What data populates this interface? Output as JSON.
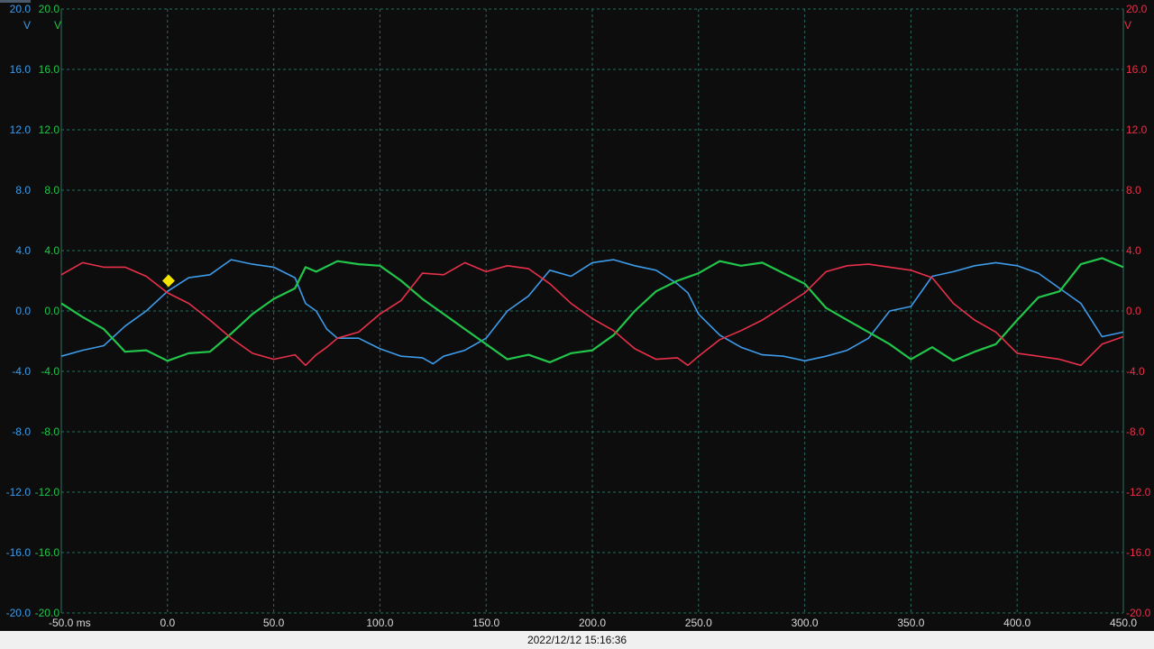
{
  "chart_data": {
    "type": "line",
    "x_unit_label": "ms",
    "xlim": [
      -50,
      450
    ],
    "x_ticks": [
      {
        "v": -50,
        "label": "-50.0 ms"
      },
      {
        "v": 0,
        "label": "0.0"
      },
      {
        "v": 50,
        "label": "50.0"
      },
      {
        "v": 100,
        "label": "100.0"
      },
      {
        "v": 150,
        "label": "150.0"
      },
      {
        "v": 200,
        "label": "200.0"
      },
      {
        "v": 250,
        "label": "250.0"
      },
      {
        "v": 300,
        "label": "300.0"
      },
      {
        "v": 350,
        "label": "350.0"
      },
      {
        "v": 400,
        "label": "400.0"
      },
      {
        "v": 450,
        "label": "450.0"
      }
    ],
    "ylim": [
      -20,
      20
    ],
    "y_ticks": [
      {
        "v": 20,
        "label": "20.0"
      },
      {
        "v": 16,
        "label": "16.0"
      },
      {
        "v": 12,
        "label": "12.0"
      },
      {
        "v": 8,
        "label": "8.0"
      },
      {
        "v": 4,
        "label": "4.0"
      },
      {
        "v": 0,
        "label": "0.0"
      },
      {
        "v": -4,
        "label": "-4.0"
      },
      {
        "v": -8,
        "label": "-8.0"
      },
      {
        "v": -12,
        "label": "-12.0"
      },
      {
        "v": -16,
        "label": "-16.0"
      },
      {
        "v": -20,
        "label": "-20.0"
      }
    ],
    "grid": true,
    "axes": [
      {
        "id": "blue",
        "side": "left-outer",
        "unit": "V",
        "color": "#3d9be9"
      },
      {
        "id": "green",
        "side": "left-inner",
        "unit": "V",
        "color": "#21c64a"
      },
      {
        "id": "red",
        "side": "right",
        "unit": "V",
        "color": "#e8304a"
      }
    ],
    "series": [
      {
        "axis": "blue",
        "color": "#3d9be9",
        "x": [
          -50,
          -40,
          -30,
          -20,
          -10,
          0,
          10,
          20,
          25,
          30,
          40,
          50,
          60,
          65,
          70,
          75,
          80,
          90,
          100,
          110,
          120,
          125,
          130,
          140,
          150,
          160,
          170,
          180,
          190,
          200,
          210,
          220,
          230,
          240,
          245,
          250,
          260,
          270,
          280,
          290,
          300,
          310,
          320,
          330,
          340,
          350,
          360,
          370,
          380,
          390,
          400,
          410,
          420,
          430,
          440,
          450
        ],
        "y": [
          -3.0,
          -2.6,
          -2.3,
          -1.0,
          0.0,
          1.3,
          2.2,
          2.4,
          2.9,
          3.4,
          3.1,
          2.9,
          2.2,
          0.5,
          0.0,
          -1.2,
          -1.8,
          -1.8,
          -2.5,
          -3.0,
          -3.1,
          -3.5,
          -3.0,
          -2.6,
          -1.8,
          0.0,
          1.0,
          2.7,
          2.3,
          3.2,
          3.4,
          3.0,
          2.7,
          1.8,
          1.2,
          -0.2,
          -1.6,
          -2.4,
          -2.9,
          -3.0,
          -3.3,
          -3.0,
          -2.6,
          -1.8,
          0.0,
          0.3,
          2.3,
          2.6,
          3.0,
          3.2,
          3.0,
          2.5,
          1.5,
          0.5,
          -1.7,
          -1.4
        ]
      },
      {
        "axis": "green",
        "color": "#21c64a",
        "x": [
          -50,
          -40,
          -30,
          -20,
          -10,
          0,
          10,
          20,
          30,
          40,
          50,
          60,
          65,
          70,
          80,
          90,
          100,
          110,
          120,
          130,
          140,
          150,
          160,
          170,
          180,
          190,
          200,
          210,
          220,
          230,
          240,
          250,
          260,
          270,
          280,
          290,
          300,
          310,
          320,
          330,
          340,
          350,
          360,
          370,
          380,
          390,
          400,
          410,
          420,
          430,
          440,
          450
        ],
        "y": [
          0.5,
          -0.4,
          -1.2,
          -2.7,
          -2.6,
          -3.3,
          -2.8,
          -2.7,
          -1.5,
          -0.2,
          0.8,
          1.5,
          2.9,
          2.6,
          3.3,
          3.1,
          3.0,
          2.0,
          0.8,
          -0.2,
          -1.2,
          -2.2,
          -3.2,
          -2.9,
          -3.4,
          -2.8,
          -2.6,
          -1.6,
          0.0,
          1.3,
          2.0,
          2.5,
          3.3,
          3.0,
          3.2,
          2.5,
          1.8,
          0.2,
          -0.6,
          -1.4,
          -2.2,
          -3.2,
          -2.4,
          -3.3,
          -2.7,
          -2.2,
          -0.6,
          0.9,
          1.3,
          3.1,
          3.5,
          2.9
        ]
      },
      {
        "axis": "red",
        "color": "#e8304a",
        "x": [
          -50,
          -40,
          -30,
          -20,
          -10,
          0,
          10,
          20,
          30,
          40,
          50,
          60,
          65,
          70,
          75,
          80,
          90,
          100,
          110,
          120,
          130,
          140,
          150,
          160,
          170,
          180,
          190,
          200,
          210,
          220,
          230,
          240,
          245,
          250,
          260,
          270,
          280,
          290,
          300,
          310,
          320,
          330,
          340,
          350,
          360,
          370,
          380,
          390,
          400,
          410,
          420,
          430,
          440,
          450
        ],
        "y": [
          2.4,
          3.2,
          2.9,
          2.9,
          2.3,
          1.2,
          0.5,
          -0.6,
          -1.8,
          -2.8,
          -3.2,
          -2.9,
          -3.6,
          -2.9,
          -2.4,
          -1.8,
          -1.4,
          -0.2,
          0.7,
          2.5,
          2.4,
          3.2,
          2.6,
          3.0,
          2.8,
          1.8,
          0.5,
          -0.5,
          -1.3,
          -2.5,
          -3.2,
          -3.1,
          -3.6,
          -3.0,
          -1.9,
          -1.3,
          -0.6,
          0.3,
          1.2,
          2.6,
          3.0,
          3.1,
          2.9,
          2.7,
          2.2,
          0.5,
          -0.6,
          -1.4,
          -2.8,
          -3.0,
          -3.2,
          -3.6,
          -2.2,
          -1.7
        ]
      }
    ],
    "trigger_marker": {
      "x": 0.5,
      "y": 2.0,
      "color": "#f5e400"
    }
  },
  "status": {
    "timestamp": "2022/12/12 15:16:36"
  }
}
